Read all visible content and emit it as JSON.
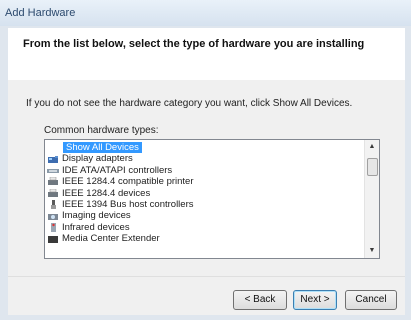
{
  "window": {
    "title": "Add Hardware"
  },
  "header": {
    "heading": "From the list below, select the type of hardware you are installing"
  },
  "instructions": "If you do not see the hardware category you want, click Show All Devices.",
  "list": {
    "label": "Common hardware types:",
    "items": [
      {
        "label": "Show All Devices",
        "icon": "none",
        "selected": true
      },
      {
        "label": "Display adapters",
        "icon": "display-adapter-icon"
      },
      {
        "label": "IDE ATA/ATAPI controllers",
        "icon": "ide-controller-icon"
      },
      {
        "label": "IEEE 1284.4 compatible printer",
        "icon": "printer-icon"
      },
      {
        "label": "IEEE 1284.4 devices",
        "icon": "printer-icon"
      },
      {
        "label": "IEEE 1394 Bus host controllers",
        "icon": "bus-controller-icon"
      },
      {
        "label": "Imaging devices",
        "icon": "imaging-device-icon"
      },
      {
        "label": "Infrared devices",
        "icon": "infrared-icon"
      },
      {
        "label": "Media Center Extender",
        "icon": "media-center-icon"
      }
    ]
  },
  "buttons": {
    "back": "< Back",
    "next": "Next >",
    "cancel": "Cancel"
  },
  "colors": {
    "selection": "#3399ff",
    "title_text": "#2c4a6e",
    "body_bg": "#f0f0f0"
  }
}
